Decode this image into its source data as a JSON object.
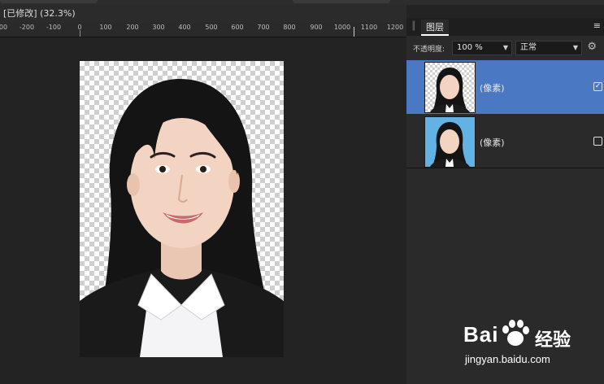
{
  "document": {
    "title": "[已修改] (32.3%)",
    "zoom": "32.3%"
  },
  "ruler": {
    "labels": [
      "00",
      "-200",
      "-100",
      "0",
      "100",
      "200",
      "300",
      "400",
      "500",
      "600",
      "700",
      "800",
      "900",
      "1000",
      "1100",
      "1200"
    ]
  },
  "panel": {
    "tab_label": "图层",
    "menu_icon": "≡",
    "opacity_label": "不透明度:",
    "opacity_value": "100 %",
    "blend_mode": "正常",
    "layers": [
      {
        "name": "(像素)",
        "selected": true,
        "visible": true,
        "thumbnail": "transparent-background-portrait"
      },
      {
        "name": "(像素)",
        "selected": false,
        "visible": false,
        "thumbnail": "blue-background-portrait"
      }
    ]
  },
  "watermark": {
    "brand": "Bai",
    "brand_suffix": "经验",
    "url": "jingyan.baidu.com"
  },
  "colors": {
    "selection": "#4a78c2",
    "panel_bg": "#2a2a2a",
    "canvas_bg": "#232323"
  }
}
